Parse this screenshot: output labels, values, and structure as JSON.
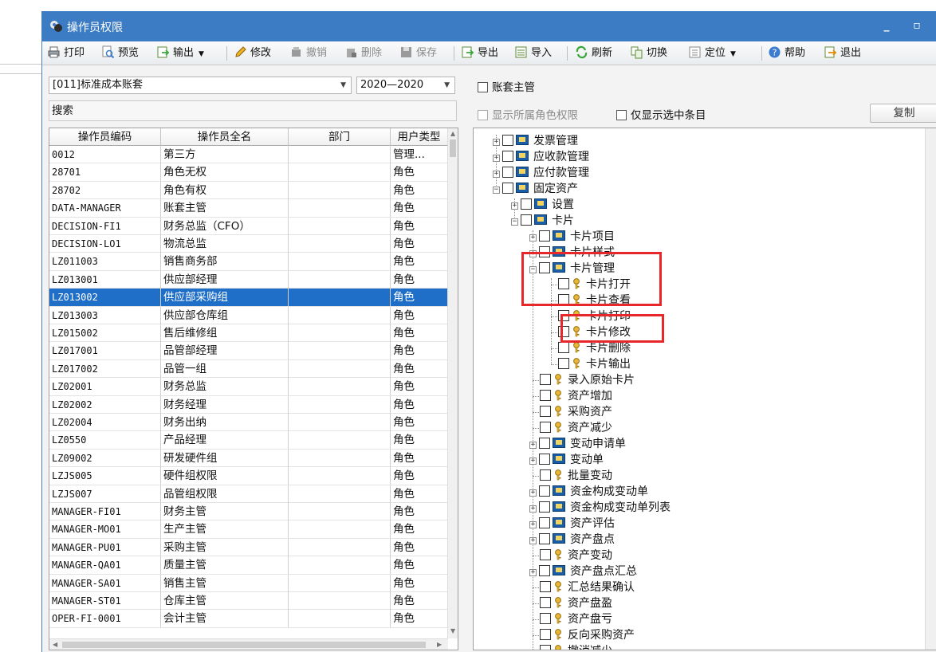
{
  "window": {
    "title": "操作员权限"
  },
  "toolbar": {
    "items": [
      {
        "label": "打印",
        "icon": "printer-icon",
        "disabled": false
      },
      {
        "label": "预览",
        "icon": "preview-icon",
        "disabled": false
      },
      {
        "label": "输出",
        "icon": "export-icon",
        "disabled": false,
        "dropdown": true
      },
      {
        "label": "修改",
        "icon": "pencil-icon",
        "disabled": false
      },
      {
        "label": "撤销",
        "icon": "undo-icon",
        "disabled": true
      },
      {
        "label": "删除",
        "icon": "delete-icon",
        "disabled": true
      },
      {
        "label": "保存",
        "icon": "save-icon",
        "disabled": true
      },
      {
        "label": "导出",
        "icon": "export-data-icon",
        "disabled": false
      },
      {
        "label": "导入",
        "icon": "import-icon",
        "disabled": false
      },
      {
        "label": "刷新",
        "icon": "refresh-icon",
        "disabled": false
      },
      {
        "label": "切换",
        "icon": "switch-icon",
        "disabled": false
      },
      {
        "label": "定位",
        "icon": "locate-icon",
        "disabled": false,
        "dropdown": true
      },
      {
        "label": "帮助",
        "icon": "help-icon",
        "disabled": false
      },
      {
        "label": "退出",
        "icon": "exit-icon",
        "disabled": false
      }
    ]
  },
  "filters": {
    "account_set": "[011]标准成本账套",
    "year_range": "2020—2020",
    "account_admin_label": "账套主管",
    "search_label": "搜索",
    "show_role_perms_label": "显示所属角色权限",
    "show_selected_only_label": "仅显示选中条目",
    "copy_button": "复制"
  },
  "operators": {
    "columns": [
      "操作员编码",
      "操作员全名",
      "部门",
      "用户类型"
    ],
    "rows": [
      [
        "0012",
        "第三方",
        "",
        "管理..."
      ],
      [
        "28701",
        "角色无权",
        "",
        "角色"
      ],
      [
        "28702",
        "角色有权",
        "",
        "角色"
      ],
      [
        "DATA-MANAGER",
        "账套主管",
        "",
        "角色"
      ],
      [
        "DECISION-FI1",
        "财务总监（CFO）",
        "",
        "角色"
      ],
      [
        "DECISION-LO1",
        "物流总监",
        "",
        "角色"
      ],
      [
        "LZ011003",
        "销售商务部",
        "",
        "角色"
      ],
      [
        "LZ013001",
        "供应部经理",
        "",
        "角色"
      ],
      [
        "LZ013002",
        "供应部采购组",
        "",
        "角色"
      ],
      [
        "LZ013003",
        "供应部仓库组",
        "",
        "角色"
      ],
      [
        "LZ015002",
        "售后维修组",
        "",
        "角色"
      ],
      [
        "LZ017001",
        "品管部经理",
        "",
        "角色"
      ],
      [
        "LZ017002",
        "品管一组",
        "",
        "角色"
      ],
      [
        "LZ02001",
        "财务总监",
        "",
        "角色"
      ],
      [
        "LZ02002",
        "财务经理",
        "",
        "角色"
      ],
      [
        "LZ02004",
        "财务出纳",
        "",
        "角色"
      ],
      [
        "LZ0550",
        "产品经理",
        "",
        "角色"
      ],
      [
        "LZ09002",
        "研发硬件组",
        "",
        "角色"
      ],
      [
        "LZJS005",
        "硬件组权限",
        "",
        "角色"
      ],
      [
        "LZJS007",
        "品管组权限",
        "",
        "角色"
      ],
      [
        "MANAGER-FI01",
        "财务主管",
        "",
        "角色"
      ],
      [
        "MANAGER-MO01",
        "生产主管",
        "",
        "角色"
      ],
      [
        "MANAGER-PU01",
        "采购主管",
        "",
        "角色"
      ],
      [
        "MANAGER-QA01",
        "质量主管",
        "",
        "角色"
      ],
      [
        "MANAGER-SA01",
        "销售主管",
        "",
        "角色"
      ],
      [
        "MANAGER-ST01",
        "仓库主管",
        "",
        "角色"
      ],
      [
        "OPER-FI-0001",
        "会计主管",
        "",
        "角色"
      ]
    ],
    "selected_index": 8
  },
  "tree": {
    "nodes": [
      {
        "label": "发票管理",
        "level": 0,
        "type": "folder",
        "expander": "+"
      },
      {
        "label": "应收款管理",
        "level": 0,
        "type": "folder",
        "expander": "+"
      },
      {
        "label": "应付款管理",
        "level": 0,
        "type": "folder",
        "expander": "+"
      },
      {
        "label": "固定资产",
        "level": 0,
        "type": "folder",
        "expander": "-"
      },
      {
        "label": "设置",
        "level": 1,
        "type": "folder",
        "expander": "+"
      },
      {
        "label": "卡片",
        "level": 1,
        "type": "folder",
        "expander": "-"
      },
      {
        "label": "卡片项目",
        "level": 2,
        "type": "folder",
        "expander": "+"
      },
      {
        "label": "卡片样式",
        "level": 2,
        "type": "folder",
        "expander": "+"
      },
      {
        "label": "卡片管理",
        "level": 2,
        "type": "folder",
        "expander": "-"
      },
      {
        "label": "卡片打开",
        "level": 3,
        "type": "key"
      },
      {
        "label": "卡片查看",
        "level": 3,
        "type": "key"
      },
      {
        "label": "卡片打印",
        "level": 3,
        "type": "key"
      },
      {
        "label": "卡片修改",
        "level": 3,
        "type": "key"
      },
      {
        "label": "卡片删除",
        "level": 3,
        "type": "key"
      },
      {
        "label": "卡片输出",
        "level": 3,
        "type": "key"
      },
      {
        "label": "录入原始卡片",
        "level": 2,
        "type": "key"
      },
      {
        "label": "资产增加",
        "level": 2,
        "type": "key"
      },
      {
        "label": "采购资产",
        "level": 2,
        "type": "key"
      },
      {
        "label": "资产减少",
        "level": 2,
        "type": "key"
      },
      {
        "label": "变动申请单",
        "level": 2,
        "type": "folder",
        "expander": "+"
      },
      {
        "label": "变动单",
        "level": 2,
        "type": "folder",
        "expander": "+"
      },
      {
        "label": "批量变动",
        "level": 2,
        "type": "key"
      },
      {
        "label": "资金构成变动单",
        "level": 2,
        "type": "folder",
        "expander": "+"
      },
      {
        "label": "资金构成变动单列表",
        "level": 2,
        "type": "folder",
        "expander": "+"
      },
      {
        "label": "资产评估",
        "level": 2,
        "type": "folder",
        "expander": "+"
      },
      {
        "label": "资产盘点",
        "level": 2,
        "type": "folder",
        "expander": "+"
      },
      {
        "label": "资产变动",
        "level": 2,
        "type": "key"
      },
      {
        "label": "资产盘点汇总",
        "level": 2,
        "type": "folder",
        "expander": "+"
      },
      {
        "label": "汇总结果确认",
        "level": 2,
        "type": "key"
      },
      {
        "label": "资产盘盈",
        "level": 2,
        "type": "key"
      },
      {
        "label": "资产盘亏",
        "level": 2,
        "type": "key"
      },
      {
        "label": "反向采购资产",
        "level": 2,
        "type": "key"
      },
      {
        "label": "撤消减少",
        "level": 2,
        "type": "key"
      }
    ]
  },
  "colors": {
    "titlebar": "#3c7cc4",
    "selection": "#1f6fc9",
    "highlight_box": "#e8272b",
    "folder_icon": "#1b5ea8",
    "key_icon": "#d9a21b"
  }
}
